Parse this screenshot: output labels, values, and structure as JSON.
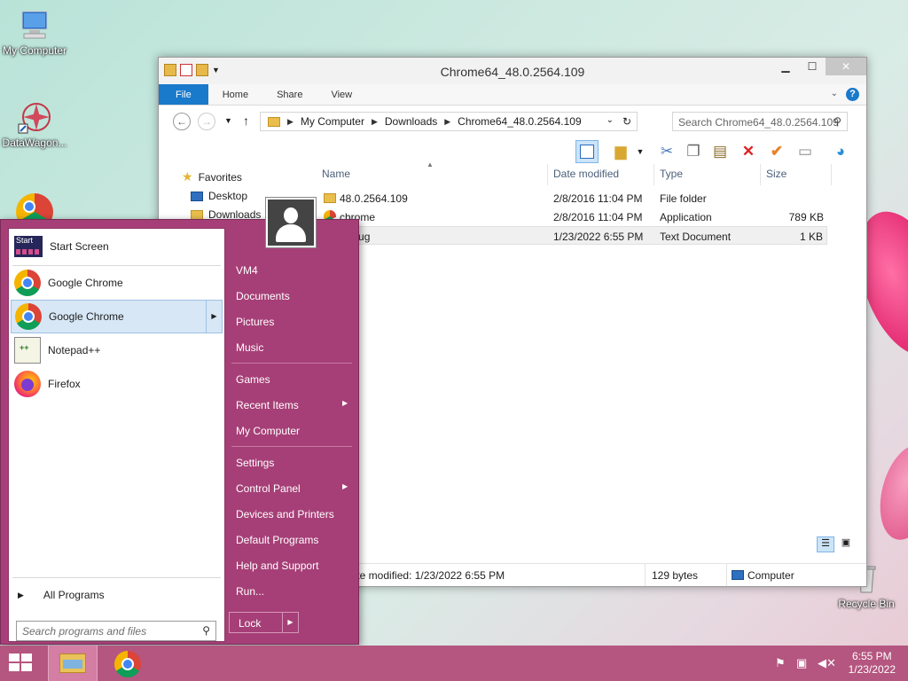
{
  "desktop": {
    "icons": [
      {
        "label": "My Computer",
        "icon": "computer-icon"
      },
      {
        "label": "DataWagon...",
        "icon": "datawagon-icon"
      },
      {
        "label": "Recycle Bin",
        "icon": "recycle-bin-icon"
      }
    ]
  },
  "explorer": {
    "title": "Chrome64_48.0.2564.109",
    "minimize": "▁",
    "maximize": "☐",
    "close": "✕",
    "ribbon_tabs": [
      "File",
      "Home",
      "Share",
      "View"
    ],
    "help": "?",
    "breadcrumb": [
      "My Computer",
      "Downloads",
      "Chrome64_48.0.2564.109"
    ],
    "search_placeholder": "Search Chrome64_48.0.2564.109",
    "columns": [
      "Name",
      "Date modified",
      "Type",
      "Size"
    ],
    "nav": {
      "favorites": "Favorites",
      "desktop": "Desktop",
      "downloads": "Downloads"
    },
    "files": [
      {
        "name": "48.0.2564.109",
        "date": "2/8/2016 11:04 PM",
        "type": "File folder",
        "size": ""
      },
      {
        "name": "chrome",
        "date": "2/8/2016 11:04 PM",
        "type": "Application",
        "size": "789 KB"
      },
      {
        "name": "debug",
        "date": "1/23/2022 6:55 PM",
        "type": "Text Document",
        "size": "1 KB"
      }
    ],
    "status": {
      "date_modified": "Date modified: 1/23/2022 6:55 PM",
      "size": "129 bytes",
      "location": "Computer"
    }
  },
  "start_menu": {
    "programs": [
      {
        "label": "Start Screen",
        "icon": "start-screen-icon"
      },
      {
        "label": "Google Chrome",
        "icon": "chrome-icon"
      },
      {
        "label": "Google Chrome",
        "icon": "chrome-icon"
      },
      {
        "label": "Notepad++",
        "icon": "notepad-plus-plus-icon"
      },
      {
        "label": "Firefox",
        "icon": "firefox-icon"
      }
    ],
    "start_icon_text": "Start",
    "all_programs": "All Programs",
    "search_placeholder": "Search programs and files",
    "right_items": [
      "VM4",
      "Documents",
      "Pictures",
      "Music",
      "Games",
      "Recent Items",
      "My Computer",
      "Settings",
      "Control Panel",
      "Devices and Printers",
      "Default Programs",
      "Help and Support",
      "Run..."
    ],
    "lock": "Lock"
  },
  "taskbar": {
    "time": "6:55 PM",
    "date": "1/23/2022"
  },
  "colors": {
    "start_menu": "#a63f77",
    "taskbar": "#b4567f",
    "ribbon_file": "#1979ca"
  }
}
